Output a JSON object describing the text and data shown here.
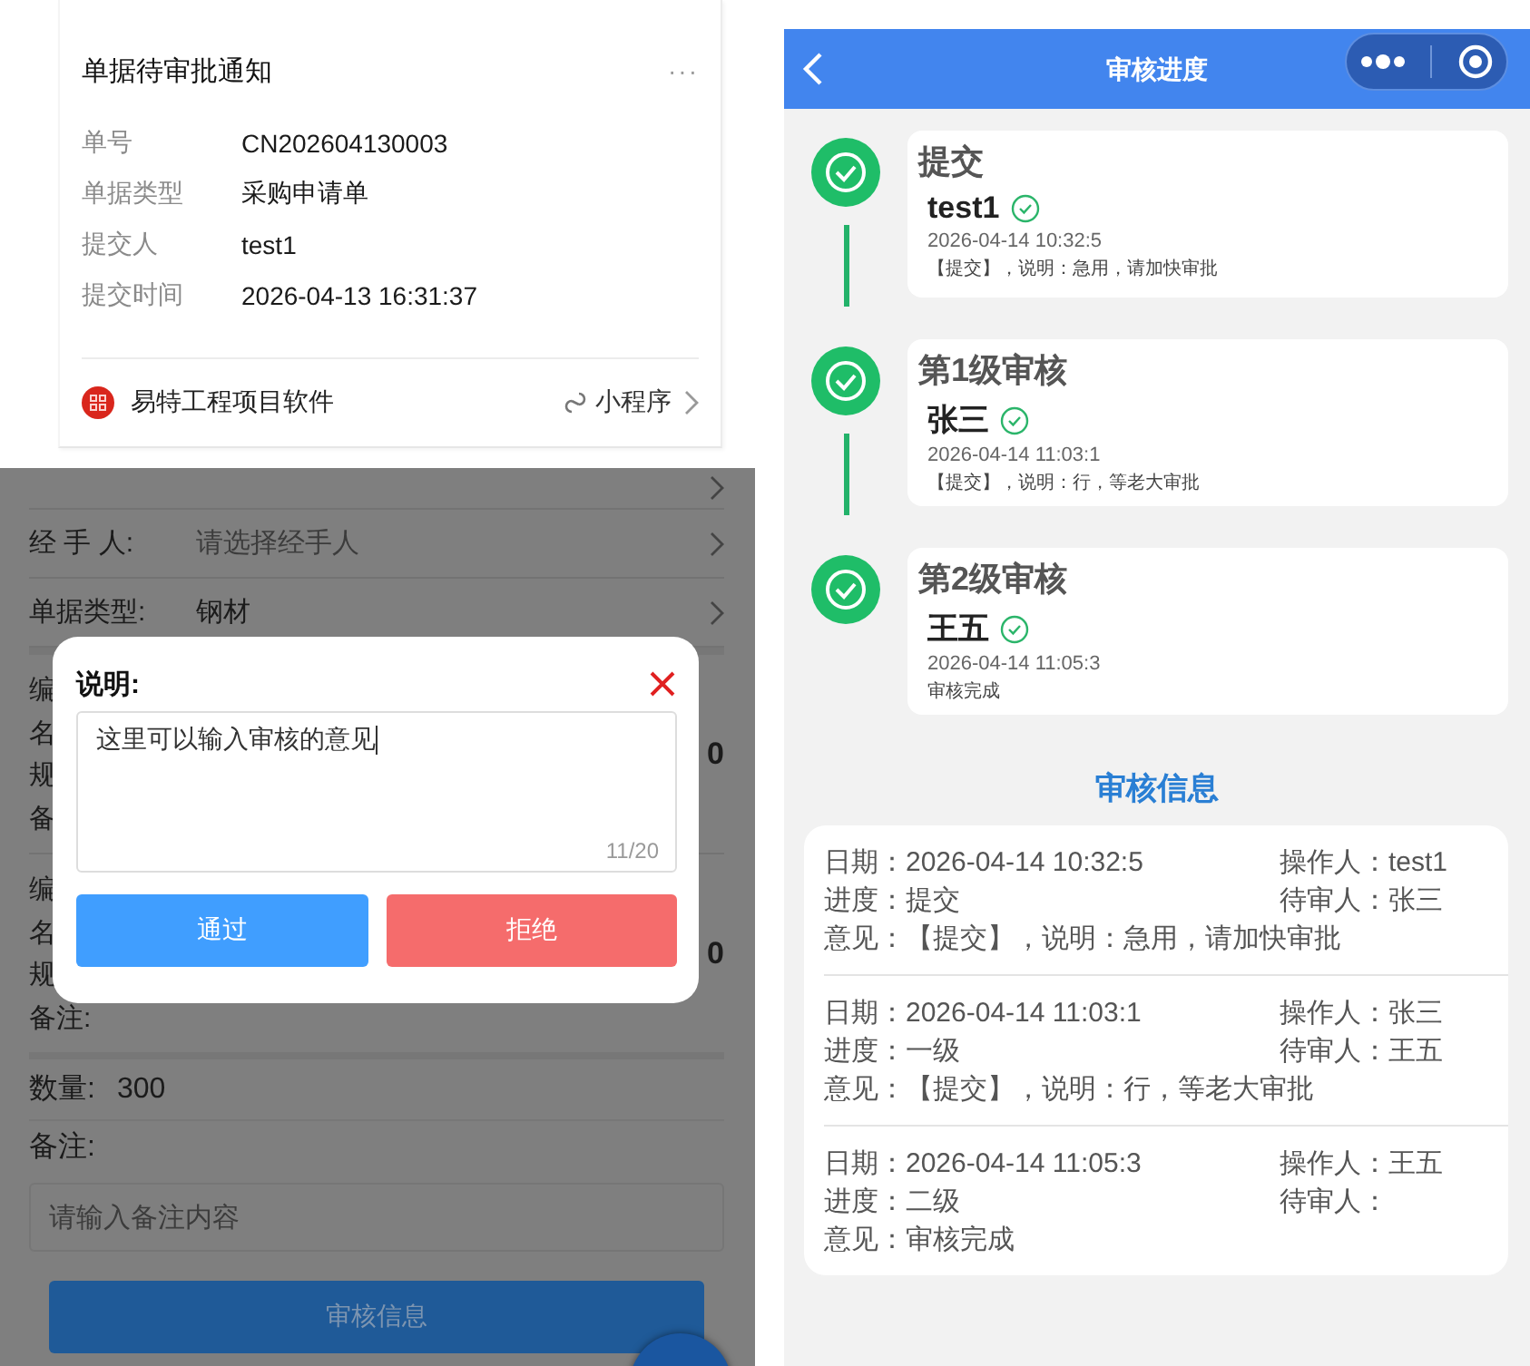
{
  "notification": {
    "title": "单据待审批通知",
    "menu": "···",
    "fields": [
      {
        "label": "单号",
        "value": "CN202604130003"
      },
      {
        "label": "单据类型",
        "value": "采购申请单"
      },
      {
        "label": "提交人",
        "value": "test1"
      },
      {
        "label": "提交时间",
        "value": "2026-04-13 16:31:37"
      }
    ],
    "app_name": "易特工程项目软件",
    "link_label": "小程序"
  },
  "form": {
    "rows": [
      {
        "kind": "clipped"
      },
      {
        "kind": "select",
        "label": "经 手 人:",
        "placeholder": "请选择经手人"
      },
      {
        "kind": "select",
        "label": "单据类型:",
        "value": "钢材"
      }
    ],
    "item_groups": [
      {
        "lines": [
          "编",
          "名",
          "规",
          "备"
        ],
        "value": "0"
      },
      {
        "lines": [
          "编",
          "名",
          "规",
          "备注:"
        ],
        "value": "0"
      }
    ],
    "quantity": {
      "label": "数量:",
      "value": "300"
    },
    "remark": {
      "label": "备注:",
      "placeholder": "请输入备注内容"
    },
    "submit_button": "审核信息"
  },
  "dialog": {
    "label": "说明:",
    "value": "这里可以输入审核的意见",
    "counter": "11/20",
    "buttons": [
      {
        "label": "通过",
        "kind": "approve"
      },
      {
        "label": "拒绝",
        "kind": "reject"
      }
    ]
  },
  "progress": {
    "title": "审核进度",
    "steps": [
      {
        "title": "提交",
        "person": "test1",
        "time": "2026-04-14 10:32:5",
        "note": "【提交】，说明：急用，请加快审批"
      },
      {
        "title": "第1级审核",
        "person": "张三",
        "time": "2026-04-14 11:03:1",
        "note": "【提交】，说明：行，等老大审批"
      },
      {
        "title": "第2级审核",
        "person": "王五",
        "time": "2026-04-14 11:05:3",
        "note": "审核完成"
      }
    ],
    "info_title": "审核信息",
    "records": [
      {
        "date": "日期：2026-04-14 10:32:5",
        "operator": "操作人：test1",
        "stage": "进度：提交",
        "next": "待审人：张三",
        "opinion": "意见：【提交】，说明：急用，请加快审批"
      },
      {
        "date": "日期：2026-04-14 11:03:1",
        "operator": "操作人：张三",
        "stage": "进度：一级",
        "next": "待审人：王五",
        "opinion": "意见：【提交】，说明：行，等老大审批"
      },
      {
        "date": "日期：2026-04-14 11:05:3",
        "operator": "操作人：王五",
        "stage": "进度：二级",
        "next": "待审人：",
        "opinion": "意见：审核完成"
      }
    ]
  }
}
